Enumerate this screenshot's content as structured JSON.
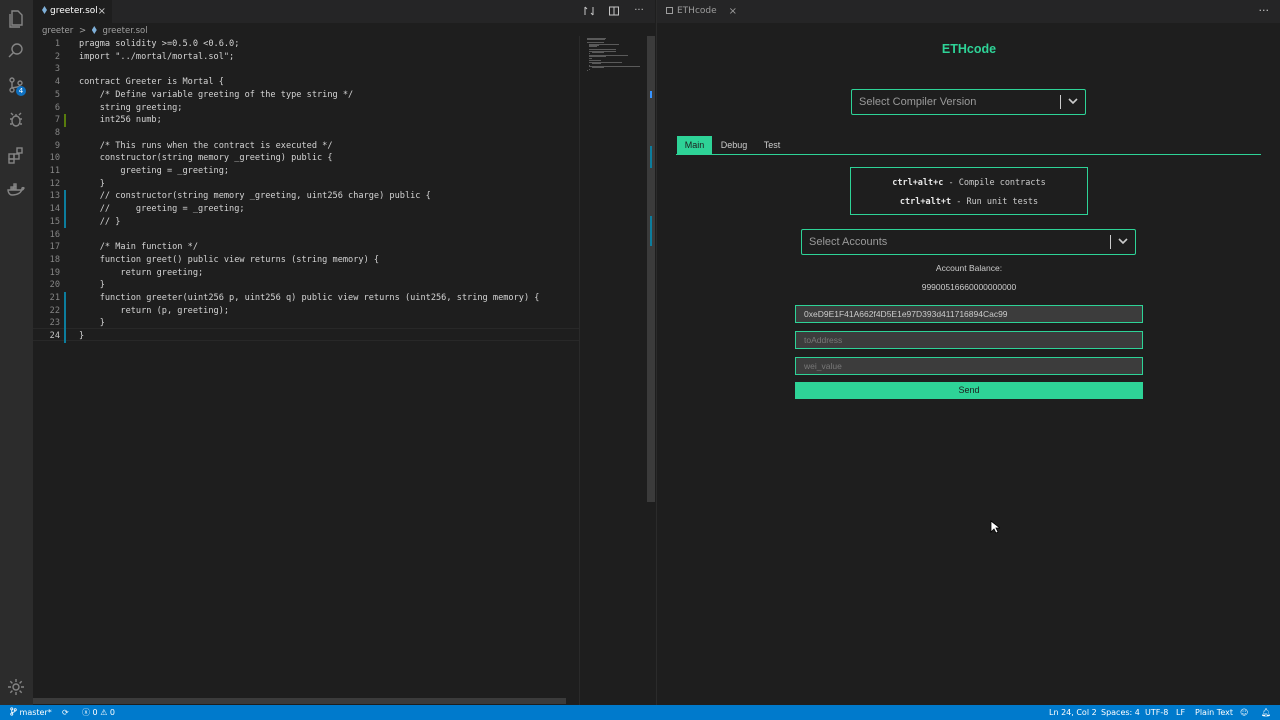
{
  "editor": {
    "tab_label": "greeter.sol",
    "tab_close": "×",
    "breadcrumb": [
      "greeter",
      "greeter.sol"
    ],
    "breadcrumb_sep": ">",
    "lines": [
      {
        "n": "1",
        "text": "pragma solidity >=0.5.0 <0.6.0;"
      },
      {
        "n": "2",
        "text": "import \"../mortal/mortal.sol\";"
      },
      {
        "n": "3",
        "text": ""
      },
      {
        "n": "4",
        "text": "contract Greeter is Mortal {"
      },
      {
        "n": "5",
        "text": "    /* Define variable greeting of the type string */"
      },
      {
        "n": "6",
        "text": "    string greeting;"
      },
      {
        "n": "7",
        "text": "    int256 numb;"
      },
      {
        "n": "8",
        "text": ""
      },
      {
        "n": "9",
        "text": "    /* This runs when the contract is executed */"
      },
      {
        "n": "10",
        "text": "    constructor(string memory _greeting) public {"
      },
      {
        "n": "11",
        "text": "        greeting = _greeting;"
      },
      {
        "n": "12",
        "text": "    }"
      },
      {
        "n": "13",
        "text": "    // constructor(string memory _greeting, uint256 charge) public {"
      },
      {
        "n": "14",
        "text": "    //     greeting = _greeting;"
      },
      {
        "n": "15",
        "text": "    // }"
      },
      {
        "n": "16",
        "text": ""
      },
      {
        "n": "17",
        "text": "    /* Main function */"
      },
      {
        "n": "18",
        "text": "    function greet() public view returns (string memory) {"
      },
      {
        "n": "19",
        "text": "        return greeting;"
      },
      {
        "n": "20",
        "text": "    }"
      },
      {
        "n": "21",
        "text": "    function greeter(uint256 p, uint256 q) public view returns (uint256, string memory) {"
      },
      {
        "n": "22",
        "text": "        return (p, greeting);"
      },
      {
        "n": "23",
        "text": "    }"
      },
      {
        "n": "24",
        "text": "}"
      }
    ]
  },
  "panel": {
    "tab_label": "ETHcode",
    "tab_close": "×",
    "title": "ETHcode",
    "compiler_select": "Select Compiler Version",
    "tabs": [
      "Main",
      "Debug",
      "Test"
    ],
    "shortcuts": [
      {
        "keys": "ctrl+alt+c",
        "desc": " - Compile contracts"
      },
      {
        "keys": "ctrl+alt+t",
        "desc": " - Run unit tests"
      }
    ],
    "accounts_select": "Select Accounts",
    "balance_label": "Account Balance:",
    "balance_value": "99900516660000000000",
    "from_address": "0xeD9E1F41A662f4D5E1e97D393d411716894Cac99",
    "to_placeholder": "toAddress",
    "wei_placeholder": "wei_value",
    "send_label": "Send"
  },
  "statusbar": {
    "branch": "master*",
    "problems": "0",
    "warnings": "0",
    "position": "Ln 24, Col 2",
    "spaces": "Spaces: 4",
    "encoding": "UTF-8",
    "eol": "LF",
    "language": "Plain Text"
  },
  "activity": {
    "scm_badge": "4",
    "icons": [
      "files-icon",
      "search-icon",
      "source-control-icon",
      "debug-icon",
      "extensions-icon",
      "docker-icon",
      "settings-gear-icon"
    ]
  },
  "colors": {
    "accent": "#2ed397",
    "statusbar": "#007acc",
    "background": "#1e1e1e"
  }
}
